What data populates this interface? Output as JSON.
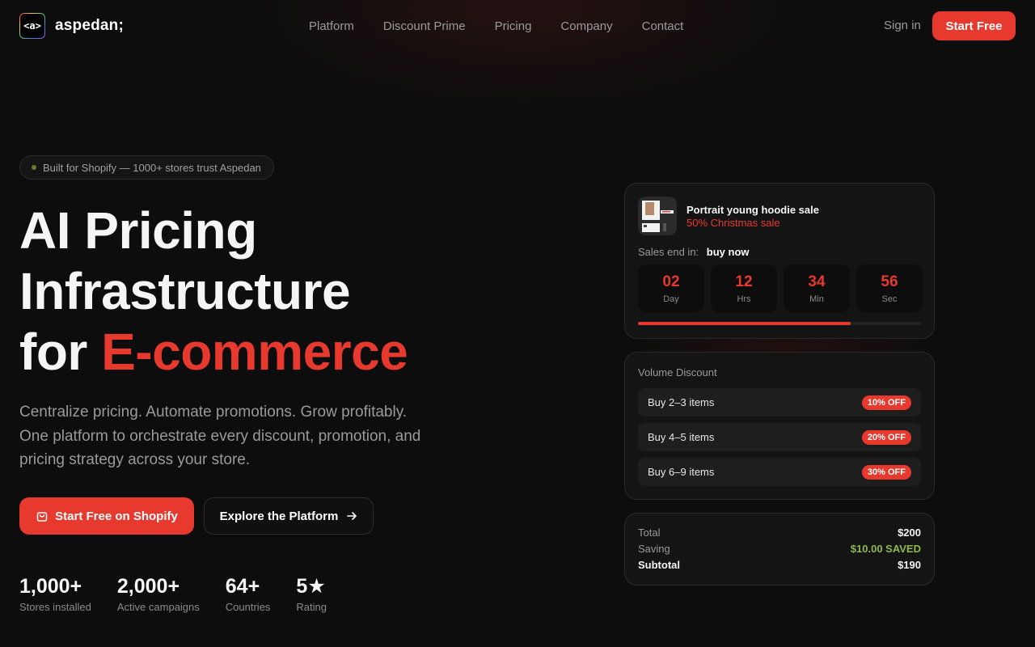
{
  "header": {
    "logo_mark": "<a>",
    "logo_text": "aspedan;",
    "nav": [
      "Platform",
      "Discount Prime",
      "Pricing",
      "Company",
      "Contact"
    ],
    "sign_in": "Sign in",
    "start_free": "Start Free"
  },
  "hero": {
    "badge": "Built for Shopify — 1000+ stores trust Aspedan",
    "title_line1": "AI Pricing",
    "title_line2": "Infrastructure",
    "title_line3_prefix": "for ",
    "title_accent": "E-commerce",
    "subtitle": "Centralize pricing. Automate promotions. Grow profitably. One platform to orchestrate every discount, promotion, and pricing strategy across your store.",
    "cta_primary": "Start Free on Shopify",
    "cta_secondary": "Explore the Platform",
    "stats": [
      {
        "value": "1,000+",
        "label": "Stores installed"
      },
      {
        "value": "2,000+",
        "label": "Active campaigns"
      },
      {
        "value": "64+",
        "label": "Countries"
      },
      {
        "value": "5★",
        "label": "Rating"
      }
    ]
  },
  "sale_card": {
    "product_title": "Portrait young hoodie sale",
    "product_subtitle": "50% Christmas sale",
    "sales_end_label": "Sales end in:",
    "buy_now": "buy now",
    "countdown": [
      {
        "value": "02",
        "label": "Day"
      },
      {
        "value": "12",
        "label": "Hrs"
      },
      {
        "value": "34",
        "label": "Min"
      },
      {
        "value": "56",
        "label": "Sec"
      }
    ],
    "progress": 0.75
  },
  "volume_card": {
    "title": "Volume Discount",
    "tiers": [
      {
        "label": "Buy 2–3 items",
        "badge": "10% OFF"
      },
      {
        "label": "Buy 4–5 items",
        "badge": "20% OFF"
      },
      {
        "label": "Buy 6–9 items",
        "badge": "30% OFF"
      }
    ]
  },
  "total_card": {
    "total_label": "Total",
    "total_value": "$200",
    "saving_label": "Saving",
    "saving_value": "$10.00 SAVED",
    "subtotal_label": "Subtotal",
    "subtotal_value": "$190"
  },
  "colors": {
    "accent": "#e8392f",
    "background": "#0d0d0d",
    "saving": "#8fb84a"
  }
}
